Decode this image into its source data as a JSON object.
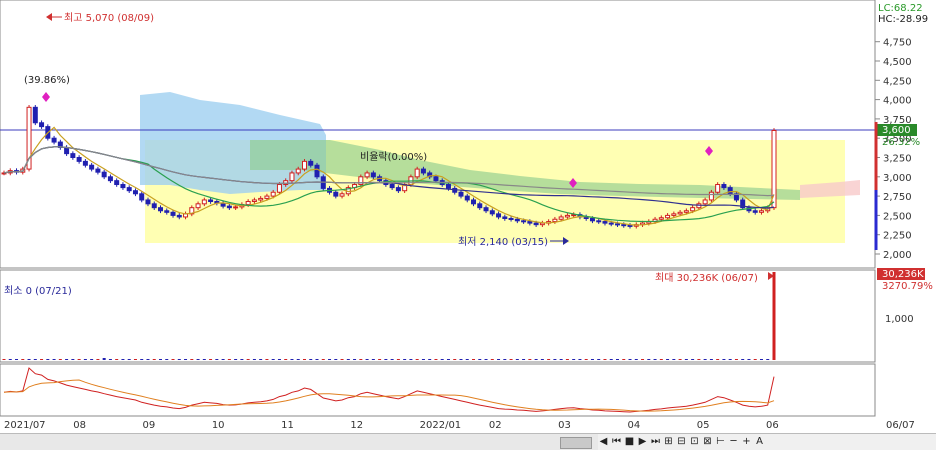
{
  "chart_data": {
    "type": "candlestick",
    "ylim": [
      2000,
      5070
    ],
    "yticks": [
      2000,
      2250,
      2500,
      2750,
      3000,
      3250,
      3500,
      3750,
      4000,
      4250,
      4500,
      4750
    ],
    "ytick_labels": [
      "2,000",
      "2,250",
      "2,500",
      "2,750",
      "3,000",
      "3,250",
      "3,500",
      "3,750",
      "4,000",
      "4,250",
      "4,500",
      "4,750"
    ],
    "xtick_labels": [
      "2021/07",
      "08",
      "09",
      "10",
      "11",
      "12",
      "2022/01",
      "02",
      "03",
      "04",
      "05",
      "06",
      "06/07"
    ],
    "annotations": {
      "high": "최고 5,070 (08/09)",
      "low": "최저 2,140 (03/15)",
      "pct_top": "(39.86%)",
      "mid": "비율락(0.00%)",
      "vol_max": "최대 30,236K (06/07)",
      "vol_min": "최소 0 (07/21)"
    },
    "top_right": {
      "lc": "LC:68.22",
      "hc": "HC:-28.99"
    },
    "current_price": {
      "value": 3600,
      "label": "3,600",
      "change": "26.32%"
    },
    "volume": {
      "last": "30,236K",
      "pct": "3270.79%",
      "ytick": "1,000"
    },
    "close": [
      3050,
      3080,
      3060,
      3100,
      3900,
      3700,
      3650,
      3500,
      3450,
      3380,
      3300,
      3250,
      3200,
      3150,
      3100,
      3060,
      3000,
      2950,
      2900,
      2860,
      2820,
      2780,
      2700,
      2650,
      2600,
      2560,
      2540,
      2500,
      2480,
      2520,
      2600,
      2650,
      2700,
      2680,
      2660,
      2620,
      2600,
      2610,
      2640,
      2680,
      2700,
      2720,
      2750,
      2800,
      2900,
      2950,
      3050,
      3100,
      3200,
      3150,
      3000,
      2850,
      2800,
      2750,
      2780,
      2860,
      2900,
      3000,
      3050,
      3000,
      2950,
      2900,
      2860,
      2820,
      2900,
      3000,
      3100,
      3050,
      3000,
      2950,
      2900,
      2850,
      2800,
      2750,
      2700,
      2650,
      2600,
      2560,
      2520,
      2480,
      2460,
      2450,
      2430,
      2420,
      2400,
      2380,
      2400,
      2420,
      2450,
      2480,
      2500,
      2510,
      2480,
      2460,
      2430,
      2420,
      2400,
      2390,
      2380,
      2370,
      2360,
      2380,
      2400,
      2420,
      2450,
      2470,
      2500,
      2520,
      2540,
      2560,
      2600,
      2650,
      2700,
      2800,
      2900,
      2860,
      2780,
      2700,
      2600,
      2560,
      2540,
      2560,
      2600,
      3600
    ],
    "volume_bars": [
      0,
      0,
      0,
      0,
      0,
      0,
      0,
      0,
      0,
      0,
      0,
      0,
      0,
      0,
      0,
      0,
      2,
      0,
      0,
      0,
      0,
      0,
      0,
      0,
      0,
      0,
      0,
      0,
      0,
      0,
      0,
      0,
      0,
      0,
      0,
      0,
      0,
      0,
      0,
      0,
      0,
      0,
      0,
      0,
      0,
      0,
      0,
      0,
      0,
      0,
      0,
      0,
      0,
      0,
      0,
      0,
      0,
      0,
      0,
      0,
      0,
      0,
      0,
      0,
      0,
      0,
      0,
      0,
      0,
      0,
      0,
      0,
      0,
      0,
      0,
      0,
      0,
      0,
      0,
      0,
      0,
      0,
      0,
      0,
      0,
      0,
      0,
      0,
      0,
      0,
      0,
      0,
      0,
      0,
      0,
      0,
      0,
      0,
      0,
      0,
      0,
      0,
      0,
      0,
      0,
      0,
      0,
      0,
      0,
      0,
      0,
      0,
      0,
      0,
      0,
      0,
      0,
      0,
      0,
      0,
      0,
      0,
      0,
      30236
    ]
  },
  "toolbar": {
    "buttons": [
      "◀",
      "⏮",
      "■",
      "▶",
      "⏭",
      "⊞",
      "⊟",
      "⊡",
      "⊠",
      "⊢",
      "─",
      "+",
      "A"
    ]
  }
}
